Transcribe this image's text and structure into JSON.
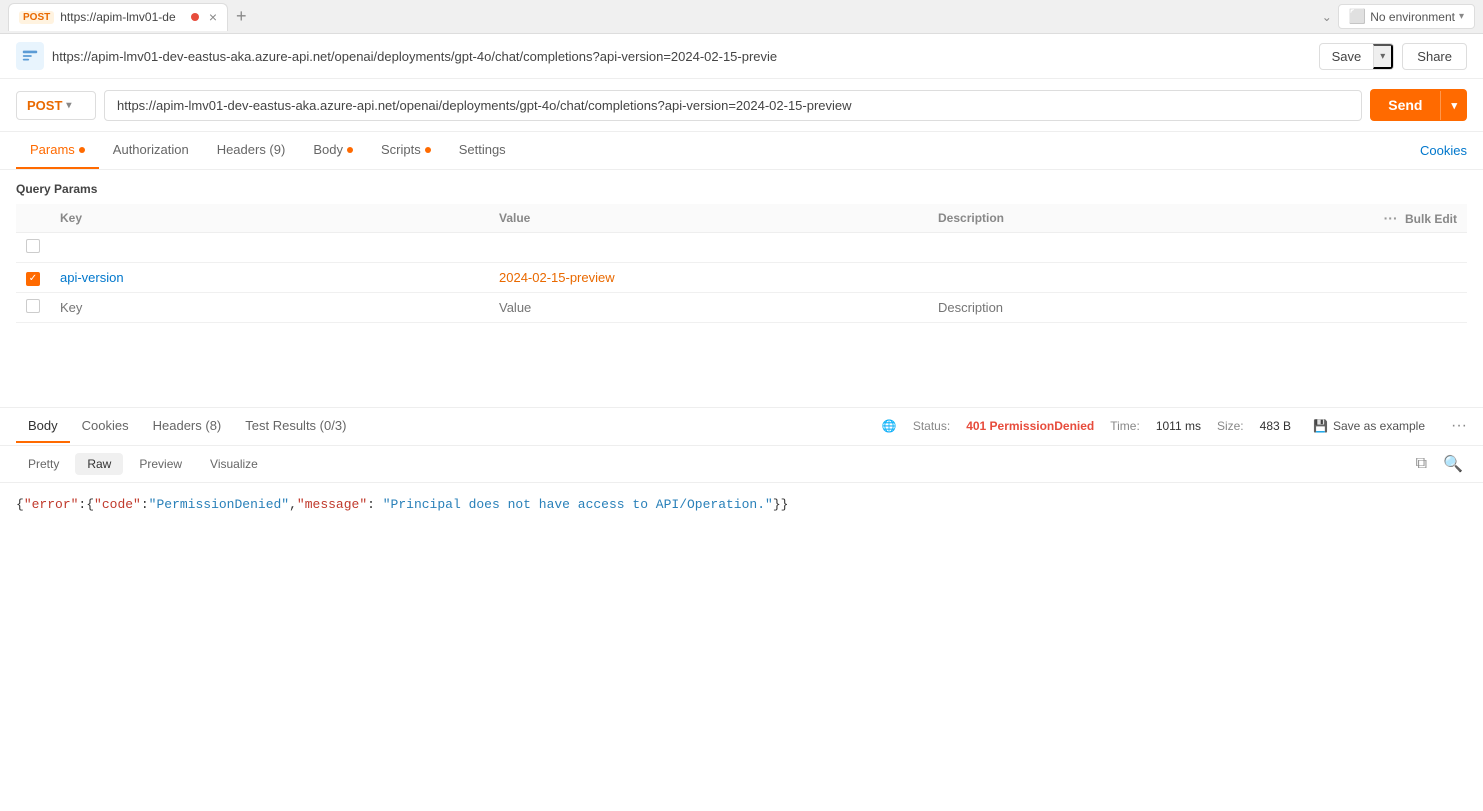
{
  "tabBar": {
    "tab": {
      "method": "POST",
      "title": "https://apim-lmv01-de",
      "dot_color": "#e74c3c"
    },
    "addTab": "+",
    "envSelector": {
      "label": "No environment",
      "icon": "no-environment-icon"
    }
  },
  "titleBar": {
    "url": "https://apim-lmv01-dev-eastus-aka.azure-api.net/openai/deployments/gpt-4o/chat/completions?api-version=2024-02-15-previe",
    "saveLabel": "Save",
    "shareLabel": "Share"
  },
  "urlBar": {
    "method": "POST",
    "url": "https://apim-lmv01-dev-eastus-aka.azure-api.net/openai/deployments/gpt-4o/chat/completions?api-version=2024-02-15-preview",
    "sendLabel": "Send"
  },
  "requestTabs": [
    {
      "id": "params",
      "label": "Params",
      "hasDot": true,
      "active": true
    },
    {
      "id": "authorization",
      "label": "Authorization",
      "hasDot": false,
      "active": false
    },
    {
      "id": "headers",
      "label": "Headers (9)",
      "hasDot": false,
      "active": false
    },
    {
      "id": "body",
      "label": "Body",
      "hasDot": true,
      "active": false
    },
    {
      "id": "scripts",
      "label": "Scripts",
      "hasDot": true,
      "active": false
    },
    {
      "id": "settings",
      "label": "Settings",
      "hasDot": false,
      "active": false
    }
  ],
  "cookiesLink": "Cookies",
  "queryParams": {
    "title": "Query Params",
    "columns": [
      "Key",
      "Value",
      "Description"
    ],
    "bulkEdit": "Bulk Edit",
    "rows": [
      {
        "id": "empty",
        "checked": false,
        "key": "",
        "value": "",
        "description": "",
        "keyPlaceholder": "",
        "valuePlaceholder": "",
        "descPlaceholder": ""
      },
      {
        "id": "api-version",
        "checked": true,
        "key": "api-version",
        "value": "2024-02-15-preview",
        "description": ""
      },
      {
        "id": "new",
        "checked": false,
        "key": "",
        "value": "",
        "description": "",
        "keyPlaceholder": "Key",
        "valuePlaceholder": "Value",
        "descPlaceholder": "Description"
      }
    ]
  },
  "responseTabs": [
    {
      "id": "body",
      "label": "Body",
      "active": true
    },
    {
      "id": "cookies",
      "label": "Cookies",
      "active": false
    },
    {
      "id": "headers",
      "label": "Headers (8)",
      "active": false
    },
    {
      "id": "testResults",
      "label": "Test Results (0/3)",
      "active": false
    }
  ],
  "responseMeta": {
    "statusLabel": "Status:",
    "statusValue": "401 PermissionDenied",
    "timeLabel": "Time:",
    "timeValue": "1011 ms",
    "sizeLabel": "Size:",
    "sizeValue": "483 B",
    "saveExampleLabel": "Save as example"
  },
  "viewTabs": [
    {
      "id": "pretty",
      "label": "Pretty",
      "active": false
    },
    {
      "id": "raw",
      "label": "Raw",
      "active": true
    },
    {
      "id": "preview",
      "label": "Preview",
      "active": false
    },
    {
      "id": "visualize",
      "label": "Visualize",
      "active": false
    }
  ],
  "responseBody": "{\"error\":{\"code\":\"PermissionDenied\",\"message\": \"Principal does not have access to API/Operation.\"}}"
}
